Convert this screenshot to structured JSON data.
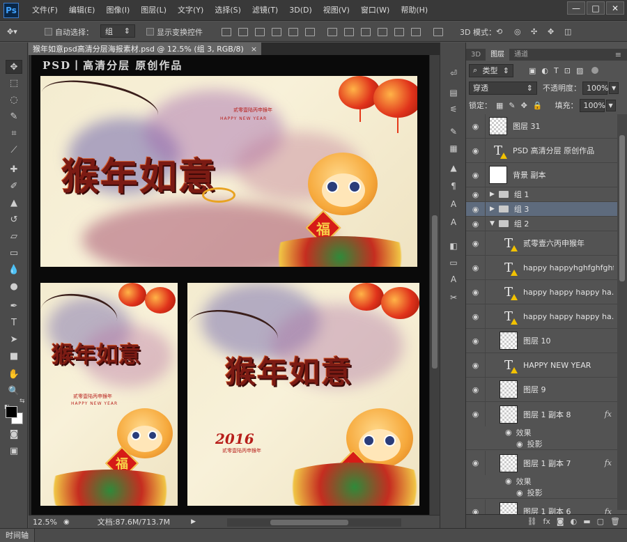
{
  "app": {
    "logo": "Ps",
    "menus": [
      "文件(F)",
      "编辑(E)",
      "图像(I)",
      "图层(L)",
      "文字(Y)",
      "选择(S)",
      "滤镜(T)",
      "3D(D)",
      "视图(V)",
      "窗口(W)",
      "帮助(H)"
    ],
    "window_controls": [
      "—",
      "□",
      "✕"
    ]
  },
  "options": {
    "auto_select_label": "自动选择：",
    "auto_select_value": "组",
    "show_transform_label": "显示变换控件",
    "mode_3d_label": "3D 模式："
  },
  "document": {
    "tab_title": "猴年如意psd高清分层海报素材.psd @ 12.5% (组 3, RGB/8)",
    "tab_close": "×",
    "header_text": "PSD丨高清分层   原创作品",
    "zoom": "12.5%",
    "doc_size": "文档:87.6M/713.7M",
    "calligraphy": "猴年如意",
    "fu_char": "福",
    "year_text": "2016",
    "happy_new_year": "HAPPY NEW YEAR",
    "seal_text": "贰零壹陆丙申猴年"
  },
  "layers_panel": {
    "tabs": [
      "3D",
      "图层",
      "通道"
    ],
    "active_tab": "图层",
    "filter_label": "类型",
    "blend_mode": "穿透",
    "opacity_label": "不透明度：",
    "opacity_value": "100%",
    "lock_label": "锁定：",
    "fill_label": "填充：",
    "fill_value": "100%",
    "layers": [
      {
        "name": "图层 31",
        "kind": "pixel"
      },
      {
        "name": "PSD 高清分层  原创作品",
        "kind": "text"
      },
      {
        "name": "背景 副本",
        "kind": "pixel-white"
      },
      {
        "name": "组 1",
        "kind": "group"
      },
      {
        "name": "组 3",
        "kind": "group",
        "selected": true
      },
      {
        "name": "组 2",
        "kind": "group-open"
      },
      {
        "name": "贰零壹六丙申猴年",
        "kind": "text"
      },
      {
        "name": "happy happyhghfghfghf...",
        "kind": "text"
      },
      {
        "name": "happy happy happy ha...",
        "kind": "text"
      },
      {
        "name": "happy happy happy ha...",
        "kind": "text"
      },
      {
        "name": "图层 10",
        "kind": "pixel"
      },
      {
        "name": "HAPPY NEW YEAR",
        "kind": "text"
      },
      {
        "name": "图层 9",
        "kind": "pixel"
      },
      {
        "name": "图层 1 副本 8",
        "kind": "pixel-fx",
        "effects_label": "效果",
        "effect": "投影"
      },
      {
        "name": "图层 1 副本 7",
        "kind": "pixel-fx",
        "effects_label": "效果",
        "effect": "投影"
      },
      {
        "name": "图层 1 副本 6",
        "kind": "pixel-fx"
      }
    ],
    "fx_label": "fx"
  },
  "timeline_label": "时间轴",
  "colors": {
    "panel_bg": "#535353",
    "selected_layer": "#5e6b7d",
    "ps_blue": "#3fa2ff",
    "warning_yellow": "#f2c200"
  }
}
